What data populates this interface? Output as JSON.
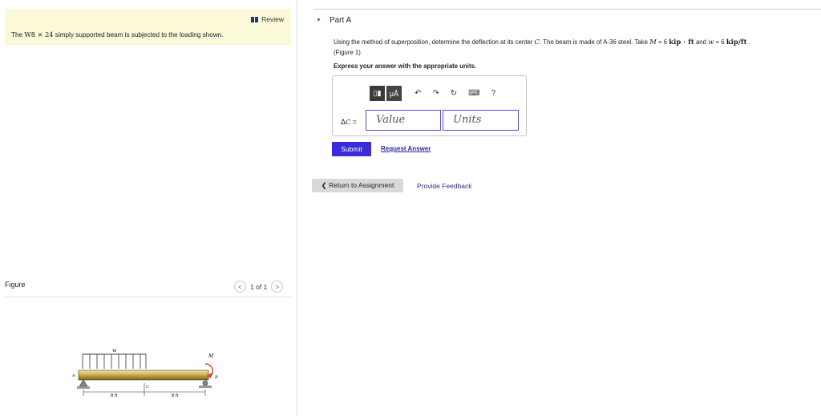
{
  "left": {
    "review_label": "Review",
    "problem_prefix": "The ",
    "problem_shape": "W8 × 24",
    "problem_suffix": " simply supported beam is subjected to the loading shown.",
    "figure_label": "Figure",
    "pager_prev": "<",
    "pager_text": "1 of 1",
    "pager_next": ">",
    "fig": {
      "w_label": "w",
      "m_label": "M",
      "a_label": "A",
      "b_label": "B",
      "c_label": "C",
      "dim_left": "8 ft",
      "dim_right": "8 ft"
    }
  },
  "right": {
    "part_arrow": "▼",
    "part_title": "Part A",
    "q1": "Using the method of superposition, determine the deflection at its center ",
    "q_c": "C",
    "q2": ". The beam is made of A-36 steel. Take ",
    "q_M": "M",
    "q3": " = 6 ",
    "q_unit1": "kip · ft",
    "q4": " and ",
    "q_w": "w",
    "q5": " = 6 ",
    "q_unit2": "kip/ft",
    "q6": " .",
    "figure_ref": "(Figure 1)",
    "express": "Express your answer with the appropriate units.",
    "toolbar": {
      "templates": "▯▮",
      "units_btn": "μÅ",
      "undo": "↶",
      "redo": "↷",
      "reset": "↻",
      "keyboard": "⌨",
      "help": "?"
    },
    "delta_label": "Δ",
    "delta_sub": "C",
    "delta_eq": " =",
    "value_placeholder": "Value",
    "units_placeholder": "Units",
    "submit": "Submit",
    "request": "Request Answer",
    "return": "❮ Return to Assignment",
    "feedback": "Provide Feedback"
  }
}
